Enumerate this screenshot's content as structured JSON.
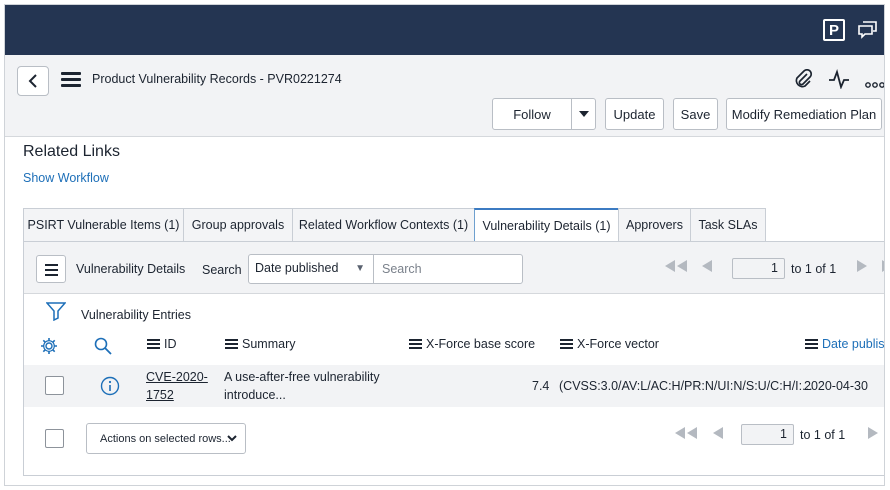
{
  "topbar": {
    "icons": [
      "p-icon",
      "chat-icon"
    ],
    "p_label": "P"
  },
  "header": {
    "title": "Product Vulnerability Records - PVR0221274",
    "buttons": {
      "follow": "Follow",
      "update": "Update",
      "save": "Save",
      "modify": "Modify Remediation Plan"
    }
  },
  "related": {
    "title": "Related Links",
    "show_workflow": "Show Workflow"
  },
  "tabs": [
    {
      "label": "PSIRT Vulnerable Items (1)",
      "active": false
    },
    {
      "label": "Group approvals",
      "active": false
    },
    {
      "label": "Related Workflow Contexts (1)",
      "active": false
    },
    {
      "label": "Vulnerability Details (1)",
      "active": true
    },
    {
      "label": "Approvers",
      "active": false
    },
    {
      "label": "Task SLAs",
      "active": false
    }
  ],
  "list": {
    "title": "Vulnerability Details",
    "search_label": "Search",
    "search_field": "Date published",
    "search_placeholder": "Search",
    "page_value": "1",
    "page_range": "to 1 of 1",
    "breadcrumb": "Vulnerability Entries",
    "columns": {
      "id": "ID",
      "summary": "Summary",
      "xforce_score": "X-Force base score",
      "xforce_vector": "X-Force vector",
      "date_published": "Date publish"
    },
    "rows": [
      {
        "id_line1": "CVE-2020-",
        "id_line2": "1752",
        "summary_line1": "A use-after-free vulnerability",
        "summary_line2": "introduce...",
        "score": "7.4",
        "vector": "(CVSS:3.0/AV:L/AC:H/PR:N/UI:N/S:U/C:H/I:...",
        "date": "2020-04-30"
      }
    ],
    "actions_label": "Actions on selected rows...",
    "footer_page_value": "1",
    "footer_page_range": "to 1 of 1"
  },
  "colors": {
    "topbar": "#243552",
    "link": "#1d6fb8",
    "active_tab_border": "#3c7bc2"
  }
}
